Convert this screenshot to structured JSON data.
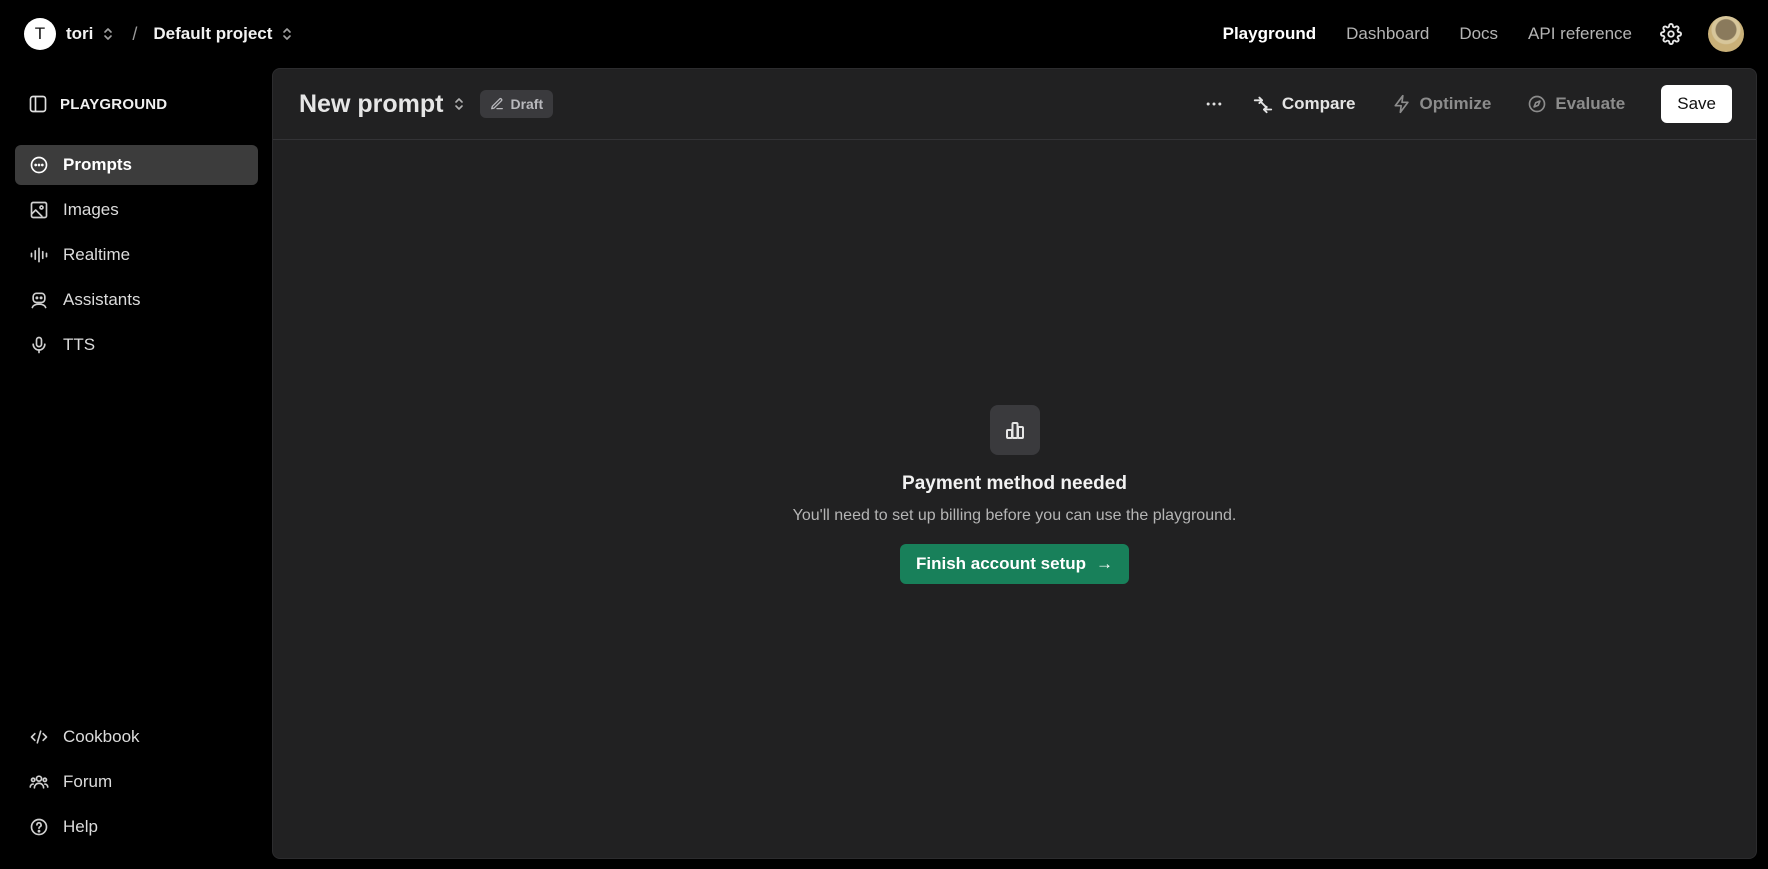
{
  "topbar": {
    "org_initial": "T",
    "org_name": "tori",
    "separator": "/",
    "project_name": "Default project",
    "nav": [
      "Playground",
      "Dashboard",
      "Docs",
      "API reference"
    ],
    "active_nav": "Playground",
    "icons": [
      "chevron-updown-icon",
      "gear-icon",
      "user-avatar"
    ]
  },
  "sidebar": {
    "header": "PLAYGROUND",
    "items": [
      {
        "label": "Prompts",
        "icon": "chat-bubble-icon",
        "active": true
      },
      {
        "label": "Images",
        "icon": "image-icon",
        "active": false
      },
      {
        "label": "Realtime",
        "icon": "waveform-icon",
        "active": false
      },
      {
        "label": "Assistants",
        "icon": "robot-icon",
        "active": false
      },
      {
        "label": "TTS",
        "icon": "microphone-icon",
        "active": false
      }
    ],
    "footer": [
      {
        "label": "Cookbook",
        "icon": "code-icon"
      },
      {
        "label": "Forum",
        "icon": "people-icon"
      },
      {
        "label": "Help",
        "icon": "help-circle-icon"
      }
    ]
  },
  "panel": {
    "title": "New prompt",
    "badge": "Draft",
    "actions": {
      "compare": "Compare",
      "optimize": "Optimize",
      "evaluate": "Evaluate",
      "save": "Save"
    }
  },
  "empty_state": {
    "title": "Payment method needed",
    "subtitle": "You'll need to set up billing before you can use the playground.",
    "button": "Finish account setup",
    "button_arrow": "→"
  },
  "colors": {
    "background": "#000000",
    "panel": "#212122",
    "active_item": "#3c3c3c",
    "accent_green": "#18805a",
    "disabled_text": "#8c8c8c"
  }
}
